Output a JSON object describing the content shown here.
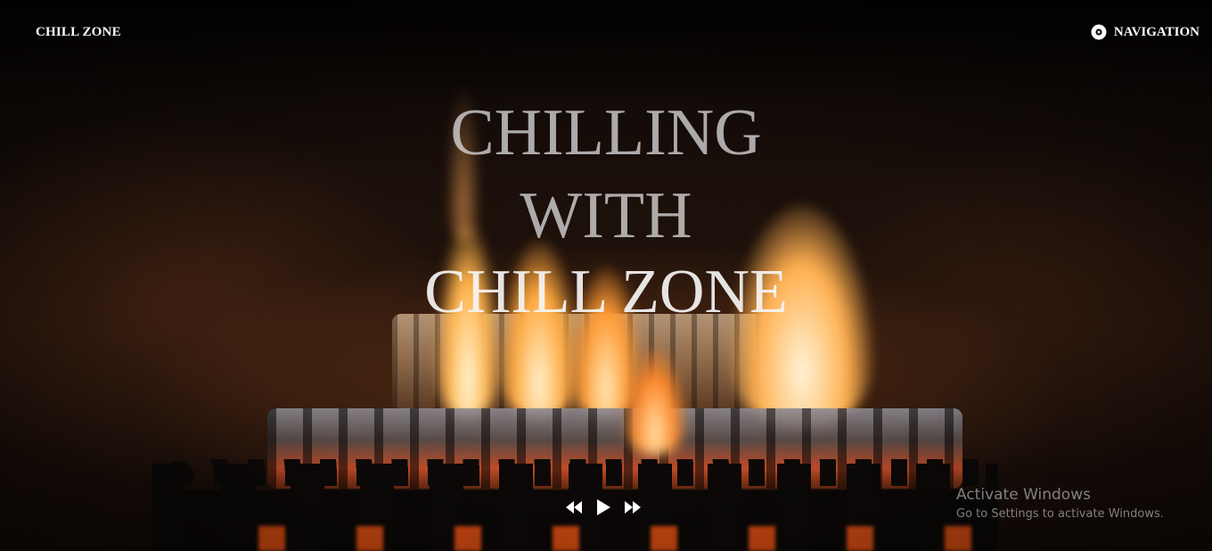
{
  "header": {
    "brand": "CHILL ZONE",
    "nav_label": "NAVIGATION",
    "nav_icon": "disc-icon"
  },
  "hero": {
    "line1": "CHILLING",
    "line2": "WITH",
    "line3": "CHILL ZONE"
  },
  "player": {
    "previous_icon": "rewind-icon",
    "play_icon": "play-icon",
    "next_icon": "fast-forward-icon"
  },
  "watermark": {
    "title": "Activate Windows",
    "subtitle": "Go to Settings to activate Windows."
  },
  "colors": {
    "text": "#ffffff",
    "hero_text": "#d7d7d7",
    "watermark_text": "#c8c8c8",
    "background": "#0a0604",
    "flame": "#ffb34a"
  }
}
